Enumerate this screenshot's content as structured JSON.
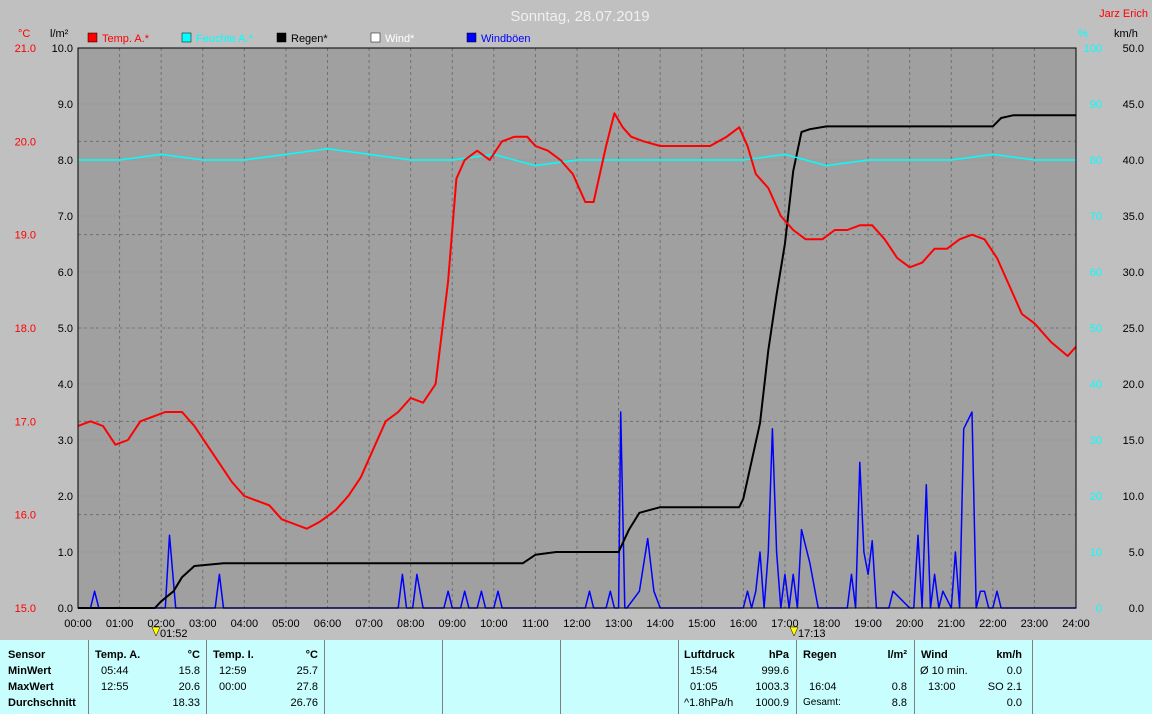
{
  "header": {
    "title": "Sonntag, 28.07.2019",
    "author": "Jarz Erich"
  },
  "units": {
    "temp": "°C",
    "rain": "l/m²",
    "hum": "%",
    "wind": "km/h"
  },
  "legend": [
    {
      "label": "Temp. A.*",
      "color": "#ff0000"
    },
    {
      "label": "Feuchte A.*",
      "color": "#00ffff"
    },
    {
      "label": "Regen*",
      "color": "#000000"
    },
    {
      "label": "Wind*",
      "color": "#ffffff"
    },
    {
      "label": "Windböen",
      "color": "#0000ff"
    }
  ],
  "markers": [
    {
      "label": "01:52"
    },
    {
      "label": "17:13"
    }
  ],
  "colors": {
    "temp": "#ff0000",
    "hum": "#00ffff",
    "rain": "#000000",
    "gust": "#0000ff",
    "wind": "#ffffff"
  },
  "chart_data": {
    "type": "line",
    "title": "Sonntag, 28.07.2019",
    "x_ticks": [
      "00:00",
      "01:00",
      "02:00",
      "03:00",
      "04:00",
      "05:00",
      "06:00",
      "07:00",
      "08:00",
      "09:00",
      "10:00",
      "11:00",
      "12:00",
      "13:00",
      "14:00",
      "15:00",
      "16:00",
      "17:00",
      "18:00",
      "19:00",
      "20:00",
      "21:00",
      "22:00",
      "23:00",
      "24:00"
    ],
    "axes": {
      "temp": {
        "ticks": [
          "15.0",
          "16.0",
          "17.0",
          "18.0",
          "19.0",
          "20.0",
          "21.0"
        ],
        "range": [
          15,
          21
        ]
      },
      "rain": {
        "ticks": [
          "0.0",
          "1.0",
          "2.0",
          "3.0",
          "4.0",
          "5.0",
          "6.0",
          "7.0",
          "8.0",
          "9.0",
          "10.0"
        ],
        "range": [
          0,
          10
        ]
      },
      "hum": {
        "ticks": [
          "0",
          "10",
          "20",
          "30",
          "40",
          "50",
          "60",
          "70",
          "80",
          "90",
          "100"
        ],
        "range": [
          0,
          100
        ]
      },
      "wind": {
        "ticks": [
          "0.0",
          "5.0",
          "10.0",
          "15.0",
          "20.0",
          "25.0",
          "30.0",
          "35.0",
          "40.0",
          "45.0",
          "50.0"
        ],
        "range": [
          0,
          50
        ]
      }
    },
    "x_range": [
      0,
      24
    ],
    "grid": true,
    "series": [
      {
        "name": "Temp. A.*",
        "axis": "temp",
        "x": [
          0,
          0.3,
          0.6,
          0.9,
          1.2,
          1.5,
          1.8,
          2.1,
          2.5,
          2.8,
          3.1,
          3.4,
          3.7,
          4.0,
          4.3,
          4.6,
          4.9,
          5.2,
          5.5,
          5.8,
          5.9,
          6.2,
          6.5,
          6.8,
          7.1,
          7.4,
          7.7,
          8.0,
          8.3,
          8.6,
          8.9,
          9.1,
          9.3,
          9.6,
          9.9,
          10.2,
          10.5,
          10.8,
          11.0,
          11.3,
          11.6,
          11.9,
          12.2,
          12.4,
          12.7,
          12.9,
          13.1,
          13.3,
          13.6,
          14.0,
          14.4,
          14.8,
          15.2,
          15.6,
          15.9,
          16.1,
          16.3,
          16.6,
          16.9,
          17.2,
          17.5,
          17.9,
          18.2,
          18.5,
          18.8,
          19.1,
          19.4,
          19.7,
          20.0,
          20.3,
          20.6,
          20.9,
          21.2,
          21.5,
          21.8,
          22.1,
          22.4,
          22.7,
          23.0,
          23.4,
          23.8,
          24.0
        ],
        "y": [
          16.95,
          17.0,
          16.95,
          16.75,
          16.8,
          17.0,
          17.05,
          17.1,
          17.1,
          16.95,
          16.75,
          16.55,
          16.35,
          16.2,
          16.15,
          16.1,
          15.95,
          15.9,
          15.85,
          15.92,
          15.95,
          16.05,
          16.2,
          16.4,
          16.7,
          17.0,
          17.1,
          17.25,
          17.2,
          17.4,
          18.5,
          19.6,
          19.8,
          19.9,
          19.8,
          20.0,
          20.05,
          20.05,
          19.95,
          19.9,
          19.8,
          19.65,
          19.35,
          19.35,
          19.95,
          20.3,
          20.15,
          20.05,
          20.0,
          19.95,
          19.95,
          19.95,
          19.95,
          20.05,
          20.15,
          19.95,
          19.65,
          19.5,
          19.2,
          19.05,
          18.95,
          18.95,
          19.05,
          19.05,
          19.1,
          19.1,
          18.95,
          18.75,
          18.65,
          18.7,
          18.85,
          18.85,
          18.95,
          19.0,
          18.95,
          18.75,
          18.45,
          18.15,
          18.05,
          17.85,
          17.7,
          17.8
        ]
      },
      {
        "name": "Feuchte A.*",
        "axis": "hum",
        "x": [
          0,
          1,
          2,
          3,
          4,
          5,
          6,
          7,
          8,
          9,
          10,
          11,
          12,
          13,
          14,
          15,
          16,
          17,
          18,
          19,
          20,
          21,
          22,
          23,
          24
        ],
        "y": [
          80,
          80,
          81,
          80,
          80,
          81,
          82,
          81,
          80,
          80,
          81,
          79,
          80,
          80,
          80,
          80,
          80,
          81,
          79,
          80,
          80,
          80,
          81,
          80,
          80
        ]
      },
      {
        "name": "Regen*",
        "axis": "rain",
        "x": [
          0,
          1.85,
          2.0,
          2.3,
          2.5,
          2.8,
          3.5,
          5,
          8,
          10.7,
          11,
          11.5,
          12,
          12.5,
          13.0,
          13.25,
          13.5,
          14.0,
          15,
          15.9,
          16.0,
          16.4,
          16.6,
          16.8,
          17.0,
          17.2,
          17.4,
          17.6,
          18.0,
          18.3,
          20,
          21,
          22.0,
          22.2,
          22.5,
          23,
          24
        ],
        "y": [
          0,
          0,
          0.12,
          0.3,
          0.55,
          0.75,
          0.8,
          0.8,
          0.8,
          0.8,
          0.95,
          1.0,
          1.0,
          1.0,
          1.0,
          1.4,
          1.7,
          1.8,
          1.8,
          1.8,
          1.95,
          3.3,
          4.6,
          5.6,
          6.5,
          7.8,
          8.5,
          8.55,
          8.6,
          8.6,
          8.6,
          8.6,
          8.6,
          8.75,
          8.8,
          8.8,
          8.8
        ]
      },
      {
        "name": "Windböen",
        "axis": "wind",
        "x": [
          0,
          0.3,
          0.4,
          0.5,
          2.1,
          2.2,
          2.35,
          3.3,
          3.4,
          3.5,
          7.7,
          7.8,
          7.9,
          8.05,
          8.15,
          8.3,
          8.8,
          8.9,
          9.0,
          9.2,
          9.3,
          9.4,
          9.6,
          9.7,
          9.8,
          10.0,
          10.1,
          10.2,
          12.2,
          12.3,
          12.4,
          12.7,
          12.8,
          12.9,
          13.0,
          13.05,
          13.15,
          13.2,
          13.5,
          13.7,
          13.85,
          14.0,
          16.0,
          16.1,
          16.2,
          16.3,
          16.4,
          16.5,
          16.6,
          16.7,
          16.8,
          16.9,
          17.0,
          17.1,
          17.2,
          17.3,
          17.4,
          17.6,
          17.8,
          18.0,
          18.5,
          18.6,
          18.7,
          18.8,
          18.9,
          19.0,
          19.1,
          19.2,
          19.4,
          19.5,
          19.6,
          20.0,
          20.1,
          20.2,
          20.3,
          20.4,
          20.5,
          20.6,
          20.7,
          20.8,
          21.0,
          21.1,
          21.2,
          21.3,
          21.5,
          21.6,
          21.7,
          21.8,
          21.9,
          22.0,
          22.1,
          22.2,
          24
        ],
        "y": [
          0,
          0,
          1.5,
          0,
          0,
          6.5,
          0,
          0,
          3,
          0,
          0,
          3,
          0,
          0,
          3,
          0,
          0,
          1.5,
          0,
          0,
          1.5,
          0,
          0,
          1.5,
          0,
          0,
          1.5,
          0,
          0,
          1.5,
          0,
          0,
          1.5,
          0,
          0,
          17.5,
          0,
          0,
          1.5,
          6.2,
          1.5,
          0,
          0,
          1.5,
          0,
          1.5,
          5,
          0,
          5,
          16,
          5,
          0,
          3,
          0,
          3,
          0,
          7,
          4,
          0,
          0,
          0,
          3,
          0,
          13,
          5,
          3,
          6,
          0,
          0,
          0,
          1.5,
          0,
          0,
          6.5,
          0,
          11,
          0,
          3,
          0,
          1.5,
          0,
          5,
          0,
          16,
          17.5,
          0,
          1.5,
          1.5,
          0,
          0,
          1.5,
          0,
          0
        ]
      }
    ]
  },
  "table": {
    "sensor": {
      "header": "Sensor",
      "rows": [
        "MinWert",
        "MaxWert",
        "Durchschnitt"
      ]
    },
    "temp_a": {
      "header": "Temp. A.",
      "unit": "°C",
      "times": [
        "05:44",
        "12:55",
        ""
      ],
      "values": [
        "15.8",
        "20.6",
        "18.33"
      ]
    },
    "temp_i": {
      "header": "Temp. I.",
      "unit": "°C",
      "times": [
        "12:59",
        "00:00",
        ""
      ],
      "values": [
        "25.7",
        "27.8",
        "26.76"
      ]
    },
    "luftdruck": {
      "header": "Luftdruck",
      "unit": "hPa",
      "times": [
        "15:54",
        "01:05",
        "^1.8hPa/h"
      ],
      "values": [
        "999.6",
        "1003.3",
        "1000.9"
      ]
    },
    "regen": {
      "header": "Regen",
      "unit": "l/m²",
      "times": [
        "",
        "16:04",
        "Gesamt:"
      ],
      "values": [
        "",
        "0.8",
        "8.8"
      ]
    },
    "wind": {
      "header": "Wind",
      "unit": "km/h",
      "times": [
        "Ø 10 min.",
        "13:00",
        ""
      ],
      "values": [
        "0.0",
        "SO 2.1",
        "0.0"
      ]
    }
  }
}
